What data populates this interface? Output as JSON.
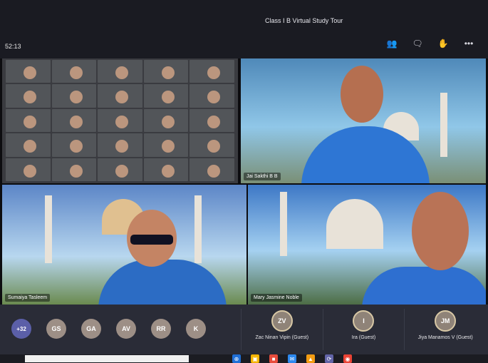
{
  "meeting": {
    "title": "Class I B Virtual Study Tour",
    "timer": "52:13"
  },
  "toolbar_icons": [
    "people-icon",
    "chat-icon",
    "raise-hand-icon",
    "more-options-icon"
  ],
  "toolbar_glyphs": [
    "👥",
    "🗨",
    "✋",
    "•••"
  ],
  "video_tiles": [
    {
      "name": ""
    },
    {
      "name": "Jai Sakthi B B"
    },
    {
      "name": "Sumaiya Tasleem"
    },
    {
      "name": "Mary Jasmine Noble"
    }
  ],
  "participant_avatars": [
    "+32",
    "GS",
    "GA",
    "AV",
    "RR",
    "K"
  ],
  "guest_tiles": [
    {
      "initials": "ZV",
      "name": "Zac Ninan Vipin (Guest)"
    },
    {
      "initials": "I",
      "name": "Ira (Guest)"
    },
    {
      "initials": "JM",
      "name": "Jiya Manamos V (Guest)"
    }
  ],
  "taskbar_apps": [
    "⊕",
    "▣",
    "■",
    "✉",
    "▲",
    "⟳",
    "◉"
  ]
}
